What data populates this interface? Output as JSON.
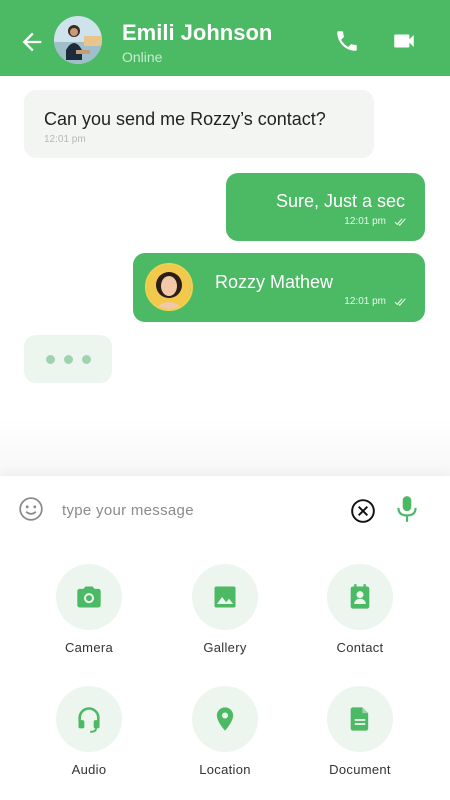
{
  "header": {
    "name": "Emili Johnson",
    "status": "Online"
  },
  "messages": {
    "incoming": {
      "text": "Can you send me Rozzy’s contact?",
      "time": "12:01 pm"
    },
    "outgoing": {
      "text": "Sure, Just a sec",
      "time": "12:01 pm"
    },
    "contact_card": {
      "name": "Rozzy Mathew",
      "time": "12:01 pm"
    }
  },
  "composer": {
    "placeholder": "type your message"
  },
  "attachments": [
    {
      "label": "Camera",
      "icon": "camera-icon"
    },
    {
      "label": "Gallery",
      "icon": "image-icon"
    },
    {
      "label": "Contact",
      "icon": "contact-icon"
    },
    {
      "label": "Audio",
      "icon": "headset-icon"
    },
    {
      "label": "Location",
      "icon": "location-pin-icon"
    },
    {
      "label": "Document",
      "icon": "document-icon"
    }
  ],
  "colors": {
    "accent": "#4cb964",
    "bubble_in": "#f2f5f2",
    "icon_bg": "#edf5ef"
  }
}
